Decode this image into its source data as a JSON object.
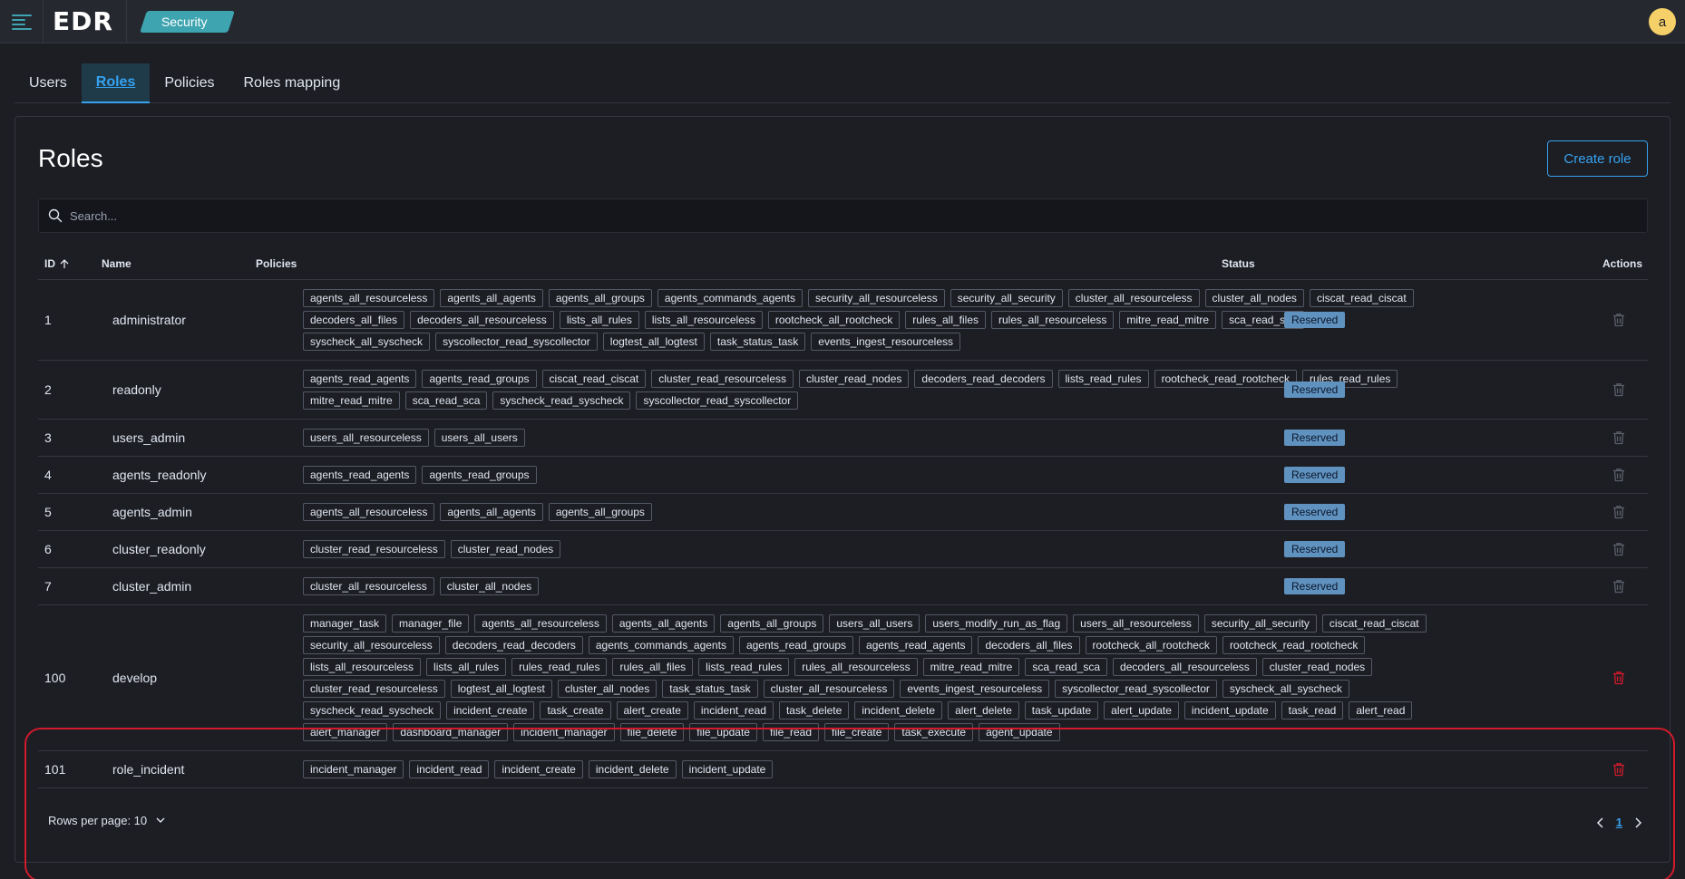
{
  "app": {
    "logo": "EDR",
    "breadcrumb": "Security",
    "avatar_initial": "a"
  },
  "tabs": [
    {
      "label": "Users",
      "active": false
    },
    {
      "label": "Roles",
      "active": true
    },
    {
      "label": "Policies",
      "active": false
    },
    {
      "label": "Roles mapping",
      "active": false
    }
  ],
  "page": {
    "title": "Roles",
    "create_button": "Create role"
  },
  "search": {
    "placeholder": "Search..."
  },
  "table": {
    "headers": {
      "id": "ID",
      "name": "Name",
      "policies": "Policies",
      "status": "Status",
      "actions": "Actions"
    },
    "rows": [
      {
        "id": "1",
        "name": "administrator",
        "status": "Reserved",
        "policies": [
          "agents_all_resourceless",
          "agents_all_agents",
          "agents_all_groups",
          "agents_commands_agents",
          "security_all_resourceless",
          "security_all_security",
          "cluster_all_resourceless",
          "cluster_all_nodes",
          "ciscat_read_ciscat",
          "decoders_all_files",
          "decoders_all_resourceless",
          "lists_all_rules",
          "lists_all_resourceless",
          "rootcheck_all_rootcheck",
          "rules_all_files",
          "rules_all_resourceless",
          "mitre_read_mitre",
          "sca_read_sca",
          "syscheck_all_syscheck",
          "syscollector_read_syscollector",
          "logtest_all_logtest",
          "task_status_task",
          "events_ingest_resourceless"
        ]
      },
      {
        "id": "2",
        "name": "readonly",
        "status": "Reserved",
        "policies": [
          "agents_read_agents",
          "agents_read_groups",
          "ciscat_read_ciscat",
          "cluster_read_resourceless",
          "cluster_read_nodes",
          "decoders_read_decoders",
          "lists_read_rules",
          "rootcheck_read_rootcheck",
          "rules_read_rules",
          "mitre_read_mitre",
          "sca_read_sca",
          "syscheck_read_syscheck",
          "syscollector_read_syscollector"
        ]
      },
      {
        "id": "3",
        "name": "users_admin",
        "status": "Reserved",
        "policies": [
          "users_all_resourceless",
          "users_all_users"
        ]
      },
      {
        "id": "4",
        "name": "agents_readonly",
        "status": "Reserved",
        "policies": [
          "agents_read_agents",
          "agents_read_groups"
        ]
      },
      {
        "id": "5",
        "name": "agents_admin",
        "status": "Reserved",
        "policies": [
          "agents_all_resourceless",
          "agents_all_agents",
          "agents_all_groups"
        ]
      },
      {
        "id": "6",
        "name": "cluster_readonly",
        "status": "Reserved",
        "policies": [
          "cluster_read_resourceless",
          "cluster_read_nodes"
        ]
      },
      {
        "id": "7",
        "name": "cluster_admin",
        "status": "Reserved",
        "policies": [
          "cluster_all_resourceless",
          "cluster_all_nodes"
        ]
      },
      {
        "id": "100",
        "name": "develop",
        "status": "",
        "policies": [
          "manager_task",
          "manager_file",
          "agents_all_resourceless",
          "agents_all_agents",
          "agents_all_groups",
          "users_all_users",
          "users_modify_run_as_flag",
          "users_all_resourceless",
          "security_all_security",
          "ciscat_read_ciscat",
          "security_all_resourceless",
          "decoders_read_decoders",
          "agents_commands_agents",
          "agents_read_groups",
          "agents_read_agents",
          "decoders_all_files",
          "rootcheck_all_rootcheck",
          "rootcheck_read_rootcheck",
          "lists_all_resourceless",
          "lists_all_rules",
          "rules_read_rules",
          "rules_all_files",
          "lists_read_rules",
          "rules_all_resourceless",
          "mitre_read_mitre",
          "sca_read_sca",
          "decoders_all_resourceless",
          "cluster_read_nodes",
          "cluster_read_resourceless",
          "logtest_all_logtest",
          "cluster_all_nodes",
          "task_status_task",
          "cluster_all_resourceless",
          "events_ingest_resourceless",
          "syscollector_read_syscollector",
          "syscheck_all_syscheck",
          "syscheck_read_syscheck",
          "incident_create",
          "task_create",
          "alert_create",
          "incident_read",
          "task_delete",
          "incident_delete",
          "alert_delete",
          "task_update",
          "alert_update",
          "incident_update",
          "task_read",
          "alert_read",
          "alert_manager",
          "dashboard_manager",
          "incident_manager",
          "file_delete",
          "file_update",
          "file_read",
          "file_create",
          "task_execute",
          "agent_update"
        ]
      },
      {
        "id": "101",
        "name": "role_incident",
        "status": "",
        "policies": [
          "incident_manager",
          "incident_read",
          "incident_create",
          "incident_delete",
          "incident_update"
        ]
      }
    ]
  },
  "footer": {
    "rows_per_page": "Rows per page: 10",
    "current_page": "1"
  },
  "colors": {
    "accent": "#36a2ef",
    "badge": "#6092c0",
    "danger": "#d11a2a",
    "breadcrumb": "#3ea4b0",
    "avatar": "#f5d068"
  }
}
